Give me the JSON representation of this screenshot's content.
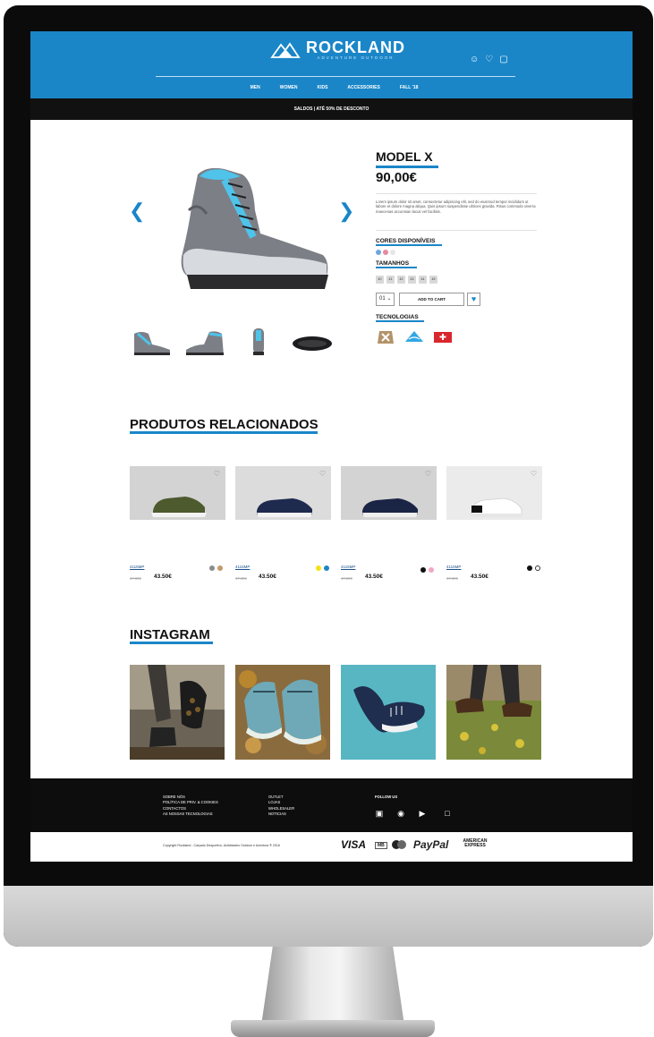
{
  "brand": {
    "name": "ROCKLAND",
    "tagline": "ADVENTURE OUTDOOR",
    "blue": "#1a86c8"
  },
  "header_icons": [
    "user-icon",
    "heart-icon",
    "bag-icon"
  ],
  "nav": [
    "MEN",
    "WOMEN",
    "KIDS",
    "ACCESSORIES",
    "FALL '18"
  ],
  "promo": "SALDOS | ATÉ 50% DE DESCONTO",
  "product": {
    "name": "MODEL X",
    "price": "90,00€",
    "description": "Lorem ipsum dolor sit amet, consectetur adipiscing elit, sed do eiusmod tempor incididunt ut labore et dolore magna aliqua. Quis ipsum suspendisse ultrices gravida. Risus commodo viverra maecenas accumsan lacus vel facilisis.",
    "colors_title": "CORES DISPONÍVEIS",
    "colors": [
      "#6fa6e0",
      "#e68aa0",
      "#e6e6e6"
    ],
    "sizes_title": "TAMANHOS",
    "sizes": [
      "40",
      "41",
      "42",
      "43",
      "44",
      "45"
    ],
    "qty": "01",
    "add_to_cart": "ADD TO CART",
    "tech_title": "TECNOLOGIAS"
  },
  "related": {
    "title": "PRODUTOS RELACIONADOS",
    "items": [
      {
        "name": "4115MP",
        "old_price": "47.00€",
        "price": "43.50€",
        "colors": [
          "#8c8c8c",
          "#c39a6b"
        ]
      },
      {
        "name": "4115MP",
        "old_price": "47.00€",
        "price": "43.50€",
        "colors": [
          "#f4e21a",
          "#1a86c8"
        ]
      },
      {
        "name": "4115MP",
        "old_price": "47.00€",
        "price": "43.50€",
        "colors": [
          "#111111",
          "#f2a6c4"
        ]
      },
      {
        "name": "4115MP",
        "old_price": "47.00€",
        "price": "43.50€",
        "colors": [
          "#111111",
          "#ffffff"
        ]
      }
    ]
  },
  "instagram": {
    "title": "INSTAGRAM"
  },
  "footer": {
    "col1": [
      "SOBRE NÓS",
      "POLÍTICA DE PRIV. & COOKIES",
      "CONTACTOS",
      "AS NOSSAS TECNOLOGIAS"
    ],
    "col2": [
      "OUTLET",
      "LOJAS",
      "WHOLESALER",
      "NOTICIAS"
    ],
    "follow": "FOLLOW US",
    "social_icons": [
      "facebook-icon",
      "instagram-icon",
      "youtube-icon",
      "google-plus-icon"
    ],
    "copyright": "Copyright Rockland - Calçado Desportivo, Actividades Outdoor e Aventura ® 2016",
    "payments": [
      "VISA",
      "MB",
      "mastercard",
      "PayPal",
      "AMERICAN EXPRESS"
    ]
  }
}
